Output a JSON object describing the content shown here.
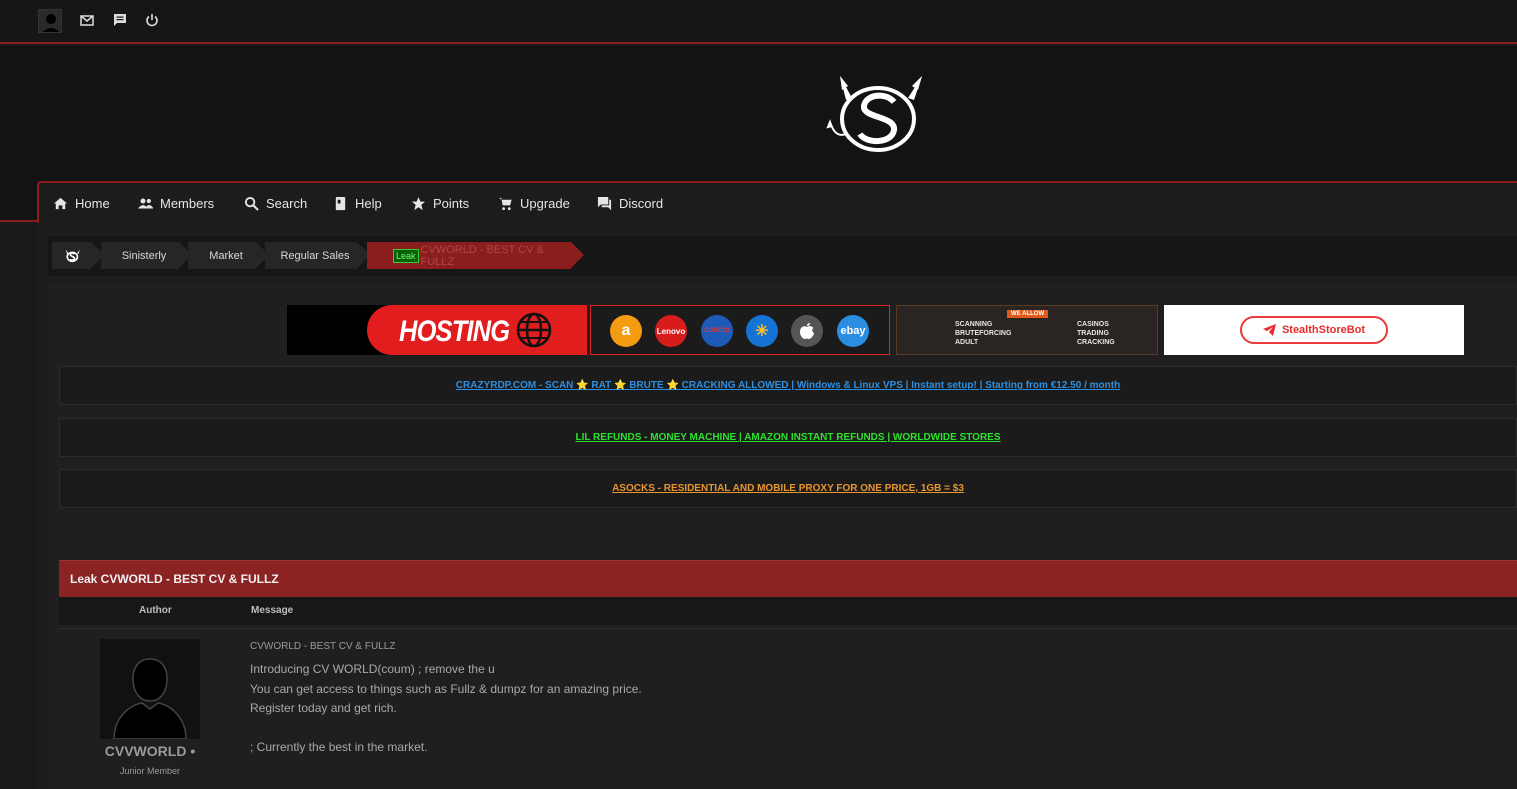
{
  "topbar": {
    "icons": [
      "avatar-icon",
      "mail-icon",
      "chat-icon",
      "power-icon"
    ]
  },
  "nav": {
    "items": [
      {
        "label": "Home",
        "icon": "home-icon"
      },
      {
        "label": "Members",
        "icon": "members-icon"
      },
      {
        "label": "Search",
        "icon": "search-icon"
      },
      {
        "label": "Help",
        "icon": "help-icon"
      },
      {
        "label": "Points",
        "icon": "star-icon"
      },
      {
        "label": "Upgrade",
        "icon": "cart-icon"
      },
      {
        "label": "Discord",
        "icon": "discord-icon"
      }
    ]
  },
  "breadcrumb": {
    "items": [
      "Sinisterly",
      "Market",
      "Regular Sales"
    ],
    "active_tag": "Leak",
    "active_label": "CVWORLD - BEST CV & FULLZ"
  },
  "banners": {
    "hosting": "HOSTING",
    "brands": [
      "a",
      "Lenovo",
      "COSTCO",
      "✳",
      "",
      "ebay"
    ],
    "scan_tag": "WE ALLOW",
    "scan_left": [
      "SCANNING",
      "BRUTEFORCING",
      "ADULT"
    ],
    "scan_right": [
      "CASINOS",
      "TRADING",
      "CRACKING"
    ],
    "stealth": "StealthStoreBot"
  },
  "announcements": [
    {
      "text": "CRAZYRDP.COM - SCAN ⭐ RAT ⭐ BRUTE ⭐ CRACKING ALLOWED | Windows & Linux VPS | Instant setup! | Starting from €12.50 / month",
      "color": "#2e8fe0"
    },
    {
      "text": "LIL REFUNDS - MONEY MACHINE | AMAZON INSTANT REFUNDS | WORLDWIDE STORES",
      "color": "#2ee02e"
    },
    {
      "text": "ASOCKS - RESIDENTIAL AND MOBILE PROXY FOR ONE PRICE, 1GB = $3",
      "color": "#e8962e"
    }
  ],
  "thread": {
    "title": "Leak CVWORLD - BEST CV & FULLZ",
    "col_author": "Author",
    "col_message": "Message",
    "post": {
      "username": "CVVWORLD •",
      "rank": "Junior Member",
      "title": "CVWORLD - BEST CV & FULLZ",
      "lines": [
        "Introducing CV WORLD(coum) ; remove the u",
        "You can get access to things such as Fullz & dumpz for an amazing price.",
        "Register today and get rich.",
        "",
        "; Currently the best in the market."
      ]
    }
  },
  "colors": {
    "accent": "#8c1d1d",
    "thread_header": "#8c2323"
  }
}
